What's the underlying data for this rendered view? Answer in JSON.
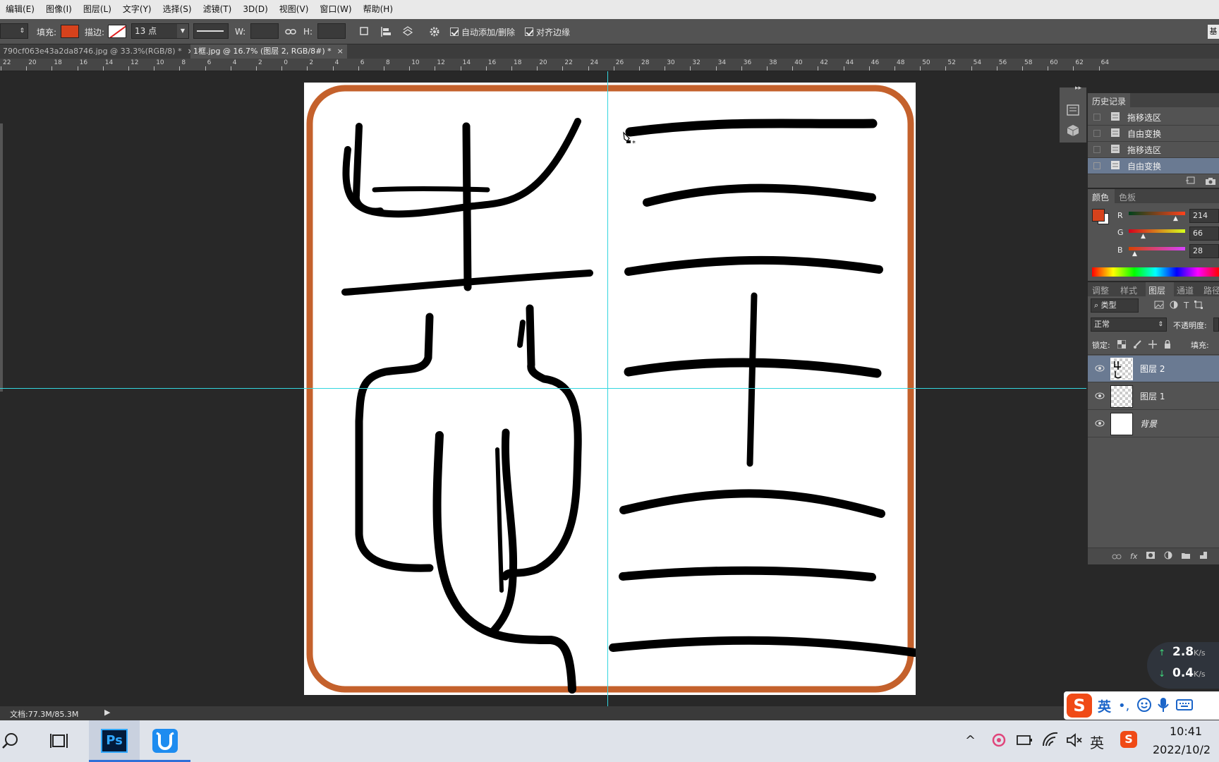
{
  "menu": [
    "编辑(E)",
    "图像(I)",
    "图层(L)",
    "文字(Y)",
    "选择(S)",
    "滤镜(T)",
    "3D(D)",
    "视图(V)",
    "窗口(W)",
    "帮助(H)"
  ],
  "options": {
    "fill_label": "填充:",
    "stroke_label": "描边:",
    "stroke_size": "13 点",
    "w_label": "W:",
    "h_label": "H:",
    "auto_add_delete": "自动添加/删除",
    "align_edges": "对齐边缘",
    "fill_color": "#d6421c",
    "right_btn": "基"
  },
  "tabs": [
    {
      "label": "790cf063e43a2da8746.jpg @ 33.3%(RGB/8) *"
    },
    {
      "label": "1框.jpg @ 16.7% (图层 2, RGB/8#) *"
    }
  ],
  "ruler_labels": [
    "22",
    "20",
    "18",
    "16",
    "14",
    "12",
    "10",
    "8",
    "6",
    "4",
    "2",
    "0",
    "2",
    "4",
    "6",
    "8",
    "10",
    "12",
    "14",
    "16",
    "18",
    "20",
    "22",
    "24",
    "26",
    "28",
    "30",
    "32",
    "34",
    "36",
    "38",
    "40",
    "42",
    "44",
    "46",
    "48",
    "50",
    "52",
    "54",
    "56",
    "58",
    "60",
    "62",
    "64"
  ],
  "status": {
    "doc_size": "文档:77.3M/85.3M"
  },
  "history": {
    "tab": "历史记录",
    "items": [
      "拖移选区",
      "自由变换",
      "拖移选区",
      "自由变换"
    ]
  },
  "color_panel": {
    "tabs": [
      "颜色",
      "色板"
    ],
    "r_label": "R",
    "g_label": "G",
    "b_label": "B",
    "r": "214",
    "g": "66",
    "b": "28",
    "fg_color": "#d6421c"
  },
  "layers_panel": {
    "tabs": [
      "调整",
      "样式",
      "图层",
      "通道",
      "路径"
    ],
    "filter_kind": "类型",
    "blend_mode": "正常",
    "opacity_label": "不透明度:",
    "lock_label": "锁定:",
    "fill_label": "填充:",
    "layers": [
      "图层 2",
      "图层 1",
      "背景"
    ]
  },
  "netspeed": {
    "up": "2.8",
    "down": "0.4",
    "unit": "K/s"
  },
  "ime": {
    "lang": "英"
  },
  "taskbar": {
    "ps_label": "Ps",
    "tray_lang": "英",
    "time": "10:41",
    "date": "2022/10/2"
  },
  "seal": {
    "border_color": "#c4612c",
    "ink_color": "#000000"
  }
}
